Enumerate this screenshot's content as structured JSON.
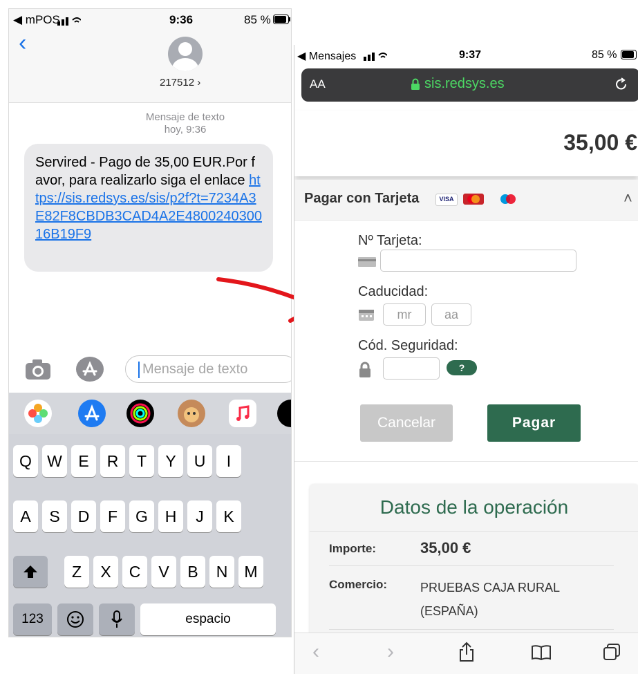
{
  "left_phone": {
    "status": {
      "carrier": "◀ mPOS",
      "time": "9:36",
      "battery": "85 %"
    },
    "contact": {
      "name": "217512 ›"
    },
    "message_meta": {
      "type": "Mensaje de texto",
      "when": "hoy, 9:36"
    },
    "message": {
      "text": "Servired - Pago de 35,00 EUR.Por favor, para realizarlo siga el enlace ",
      "link": "https://sis.redsys.es/sis/p2f?t=7234A3E82F8CBDB3CAD4A2E480024030016B19F9"
    },
    "input": {
      "placeholder": "Mensaje de texto"
    },
    "keyboard": {
      "row1": [
        "Q",
        "W",
        "E",
        "R",
        "T",
        "Y",
        "U",
        "I"
      ],
      "row2": [
        "A",
        "S",
        "D",
        "F",
        "G",
        "H",
        "J",
        "K"
      ],
      "row3": [
        "Z",
        "X",
        "C",
        "V",
        "B",
        "N",
        "M"
      ],
      "numbers_key": "123",
      "space_key": "espacio"
    }
  },
  "right_phone": {
    "status": {
      "carrier": "◀ Mensajes",
      "time": "9:37",
      "battery": "85 %"
    },
    "url_bar": {
      "text_size": "AA",
      "domain": "sis.redsys.es"
    },
    "amount": "35,00 €",
    "payment": {
      "title": "Pagar con Tarjeta",
      "card_label": "Nº Tarjeta:",
      "expiry_label": "Caducidad:",
      "month_placeholder": "mr",
      "year_placeholder": "aa",
      "cvv_label": "Cód. Seguridad:",
      "help": "?",
      "cancel": "Cancelar",
      "pay": "Pagar",
      "logos": [
        "VISA"
      ]
    },
    "operation": {
      "title": "Datos de la operación",
      "rows": [
        {
          "label": "Importe:",
          "value": "35,00 €"
        },
        {
          "label": "Comercio:",
          "value": "PRUEBAS CAJA RURAL (ESPAÑA)"
        }
      ]
    }
  },
  "colors": {
    "accent_green": "#2e6b4f",
    "ios_blue": "#1a73e8",
    "arrow_red": "#e3161b"
  }
}
